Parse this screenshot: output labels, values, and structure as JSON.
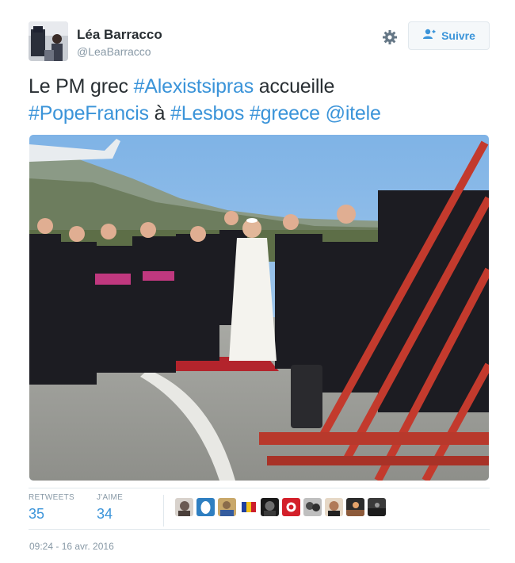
{
  "user": {
    "name": "Léa Barracco",
    "handle": "@LeaBarracco"
  },
  "actions": {
    "settings_icon": "gear-icon",
    "follow_icon": "add-user-icon",
    "follow_label": "Suivre"
  },
  "tweet": {
    "text_plain_1": "Le PM grec ",
    "hashtag_1": "#Alexistsipras",
    "text_plain_2": " accueille",
    "hashtag_2": "#PopeFrancis",
    "text_plain_3": " à ",
    "hashtag_3": "#Lesbos",
    "text_plain_4": " ",
    "hashtag_4": "#greece",
    "text_plain_5": " ",
    "mention_1": "@itele"
  },
  "stats": {
    "retweets_label": "RETWEETS",
    "retweets_count": "35",
    "likes_label": "J'AIME",
    "likes_count": "34"
  },
  "likers_count_shown": 10,
  "timestamp": "09:24 - 16 avr. 2016",
  "colors": {
    "link": "#3b94d9",
    "muted": "#8899a6",
    "text": "#292f33",
    "border": "#e1e8ed"
  }
}
